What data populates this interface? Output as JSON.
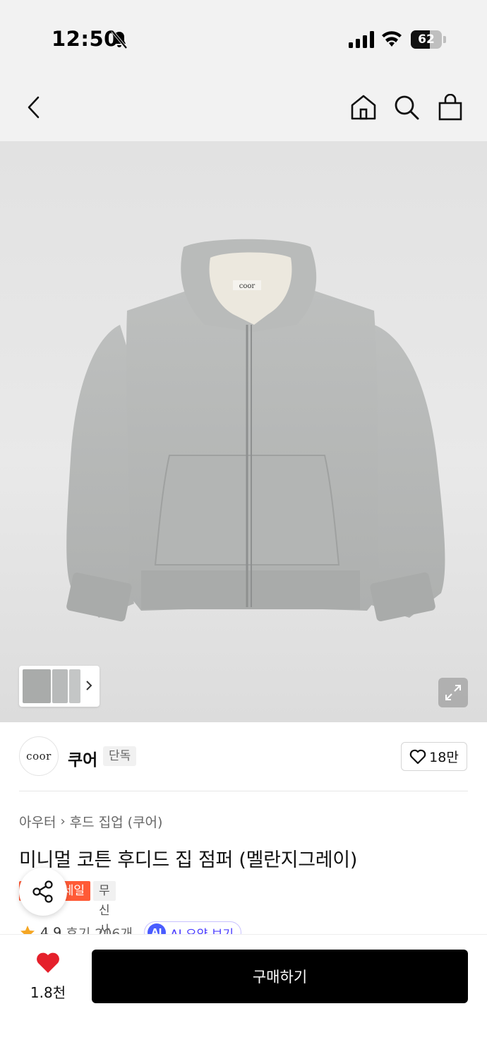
{
  "status_bar": {
    "time": "12:50",
    "battery_level": "62",
    "icons": [
      "bell-off-icon",
      "signal-icon",
      "wifi-icon",
      "battery-icon"
    ]
  },
  "nav": {
    "icons": [
      "back-chevron-icon",
      "home-icon",
      "search-icon",
      "shopping-bag-icon"
    ]
  },
  "gallery": {
    "hoodie_label": "coor",
    "image_color": "#b5b7b6",
    "thumbnail_count": 3
  },
  "brand": {
    "logo_text": "coor",
    "name": "쿠어",
    "badge": "단독",
    "like_count": "18만"
  },
  "product": {
    "breadcrumb": [
      "아우터",
      "후드 집업 (쿠어)"
    ],
    "title": "미니멀 코튼 후디드 집 점퍼 (멜란지그레이)",
    "tags": {
      "sale": "세일",
      "exclusive": "무신사단독"
    }
  },
  "rating": {
    "score": "4.9",
    "reviews": "후기 206개",
    "ai_badge": "AI",
    "ai_summary": "AI 요약 보기"
  },
  "bottom_bar": {
    "favorite_count": "1.8천",
    "buy_label": "구매하기"
  },
  "colors": {
    "accent_red": "#e5202b",
    "sale_orange": "#ff5a36",
    "star": "#f5a623",
    "ai_blue": "#4a5cff",
    "buy_button": "#000000"
  }
}
